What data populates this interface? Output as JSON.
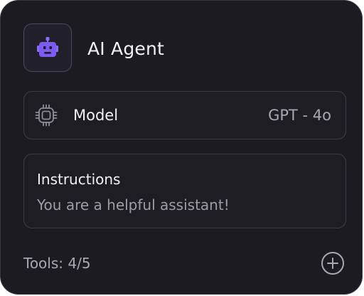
{
  "agent": {
    "title": "AI Agent",
    "icon": "robot-icon",
    "icon_color": "#7c5cf0"
  },
  "model": {
    "label": "Model",
    "value": "GPT - 4o",
    "icon": "chip-icon"
  },
  "instructions": {
    "label": "Instructions",
    "text": "You are a helpful assistant!"
  },
  "tools": {
    "label": "Tools: 4/5",
    "used": 4,
    "total": 5,
    "add_icon": "plus-circle-icon"
  }
}
